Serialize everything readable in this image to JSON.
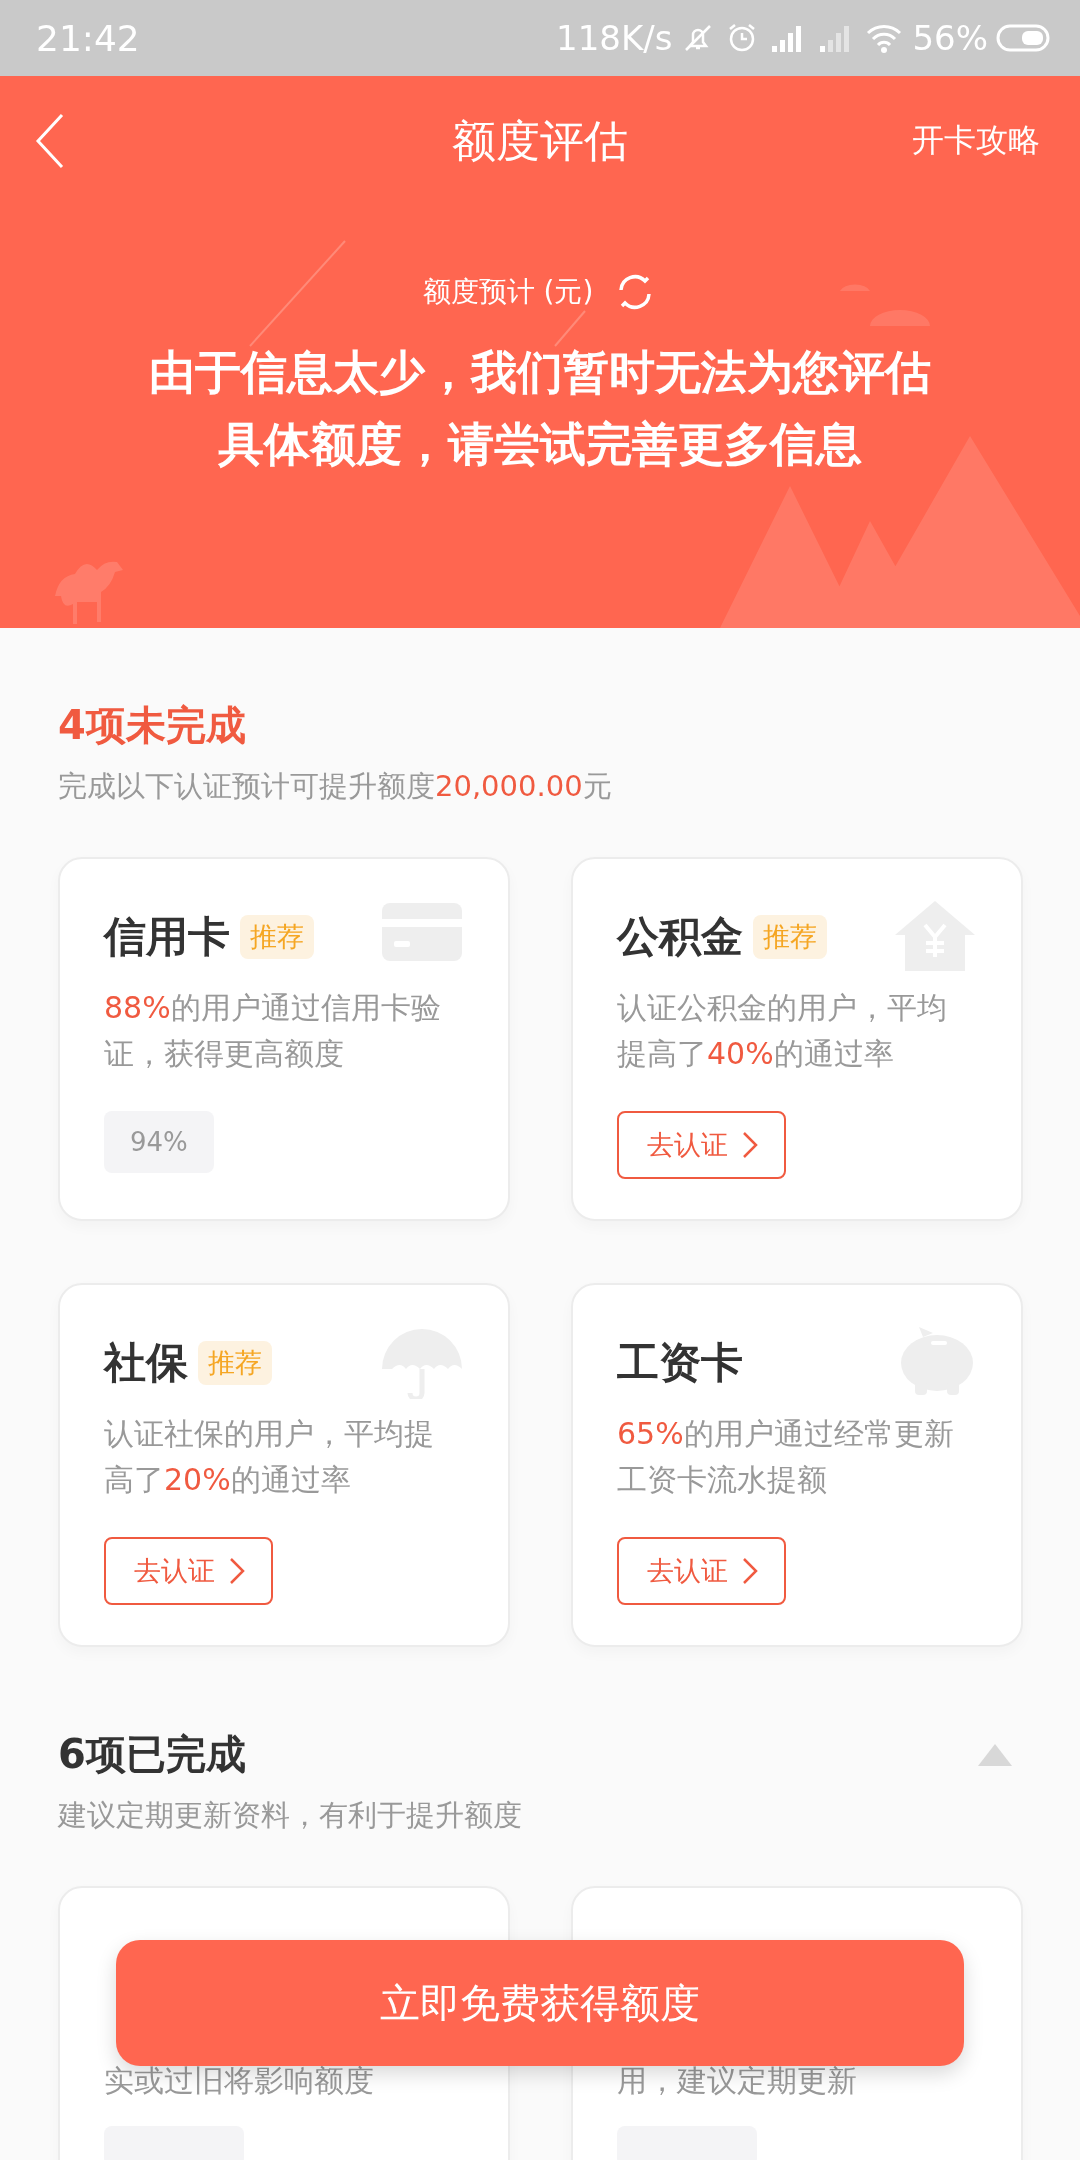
{
  "status_bar": {
    "time": "21:42",
    "speed": "118K/s",
    "battery": "56%"
  },
  "header": {
    "title": "额度评估",
    "action": "开卡攻略",
    "estimate_label": "额度预计 (元)",
    "message": "由于信息太少，我们暂时无法为您评估具体额度，请尝试完善更多信息"
  },
  "pending": {
    "title": "4项未完成",
    "subtitle": [
      {
        "text": "完成以下认证预计可提升额度",
        "highlight": false
      },
      {
        "text": "20,000.00",
        "highlight": true
      },
      {
        "text": "元",
        "highlight": false
      }
    ],
    "cards": [
      {
        "title": "信用卡",
        "tag": "推荐",
        "kind": "card",
        "desc": [
          {
            "text": "88%",
            "highlight": true
          },
          {
            "text": "的用户通过信用卡验证，获得更高额度",
            "highlight": false
          }
        ],
        "action": {
          "kind": "progress",
          "text": "94%"
        }
      },
      {
        "title": "公积金",
        "tag": "推荐",
        "kind": "house",
        "desc": [
          {
            "text": "认证公积金的用户，平均提高了",
            "highlight": false
          },
          {
            "text": "40%",
            "highlight": true
          },
          {
            "text": "的通过率",
            "highlight": false
          }
        ],
        "action": {
          "kind": "button",
          "text": "去认证"
        }
      },
      {
        "title": "社保",
        "tag": "推荐",
        "kind": "umbrella",
        "desc": [
          {
            "text": "认证社保的用户，平均提高了",
            "highlight": false
          },
          {
            "text": "20%",
            "highlight": true
          },
          {
            "text": "的通过率",
            "highlight": false
          }
        ],
        "action": {
          "kind": "button",
          "text": "去认证"
        }
      },
      {
        "title": "工资卡",
        "kind": "piggy",
        "desc": [
          {
            "text": "65%",
            "highlight": true
          },
          {
            "text": "的用户通过经常更新工资卡流水提额",
            "highlight": false
          }
        ],
        "action": {
          "kind": "button",
          "text": "去认证"
        }
      }
    ]
  },
  "completed": {
    "title": "6项已完成",
    "expanded": true,
    "subtitle": "建议定期更新资料，有利于提升额度",
    "cards": [
      {
        "desc_tail": "实或过旧将影响额度"
      },
      {
        "desc_tail": "用，建议定期更新"
      }
    ]
  },
  "cta": {
    "label": "立即免费获得额度"
  }
}
